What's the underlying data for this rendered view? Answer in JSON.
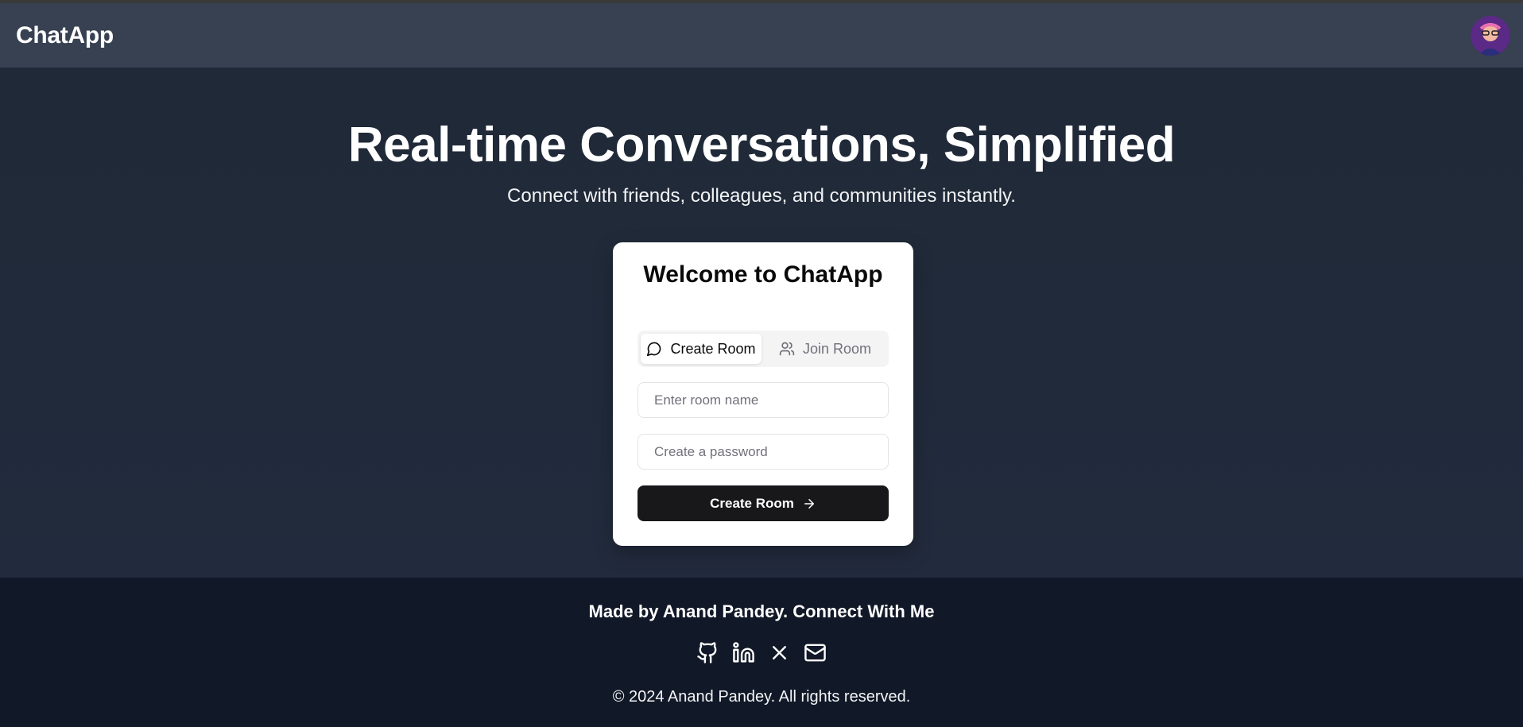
{
  "app": {
    "title": "ChatApp"
  },
  "header": {
    "brand": "ChatApp",
    "avatar_icon": "user-avatar"
  },
  "hero": {
    "title": "Real-time Conversations, Simplified",
    "subtitle": "Connect with friends, colleagues, and communities instantly."
  },
  "card": {
    "title": "Welcome to ChatApp",
    "tabs": [
      {
        "label": "Create Room",
        "icon": "message-circle-icon",
        "active": true
      },
      {
        "label": "Join Room",
        "icon": "users-icon",
        "active": false
      }
    ],
    "room_input": {
      "placeholder": "Enter room name",
      "value": ""
    },
    "password_input": {
      "placeholder": "Create a password",
      "value": ""
    },
    "submit_label": "Create Room"
  },
  "footer": {
    "credit": "Made by Anand Pandey. Connect With Me",
    "social": [
      "github-icon",
      "linkedin-icon",
      "x-icon",
      "mail-icon"
    ],
    "copyright": "© 2024 Anand Pandey. All rights reserved."
  },
  "colors": {
    "header_bg": "#374151",
    "main_bg": "#1f2937",
    "footer_bg": "#111827",
    "button_bg": "#18181b"
  }
}
